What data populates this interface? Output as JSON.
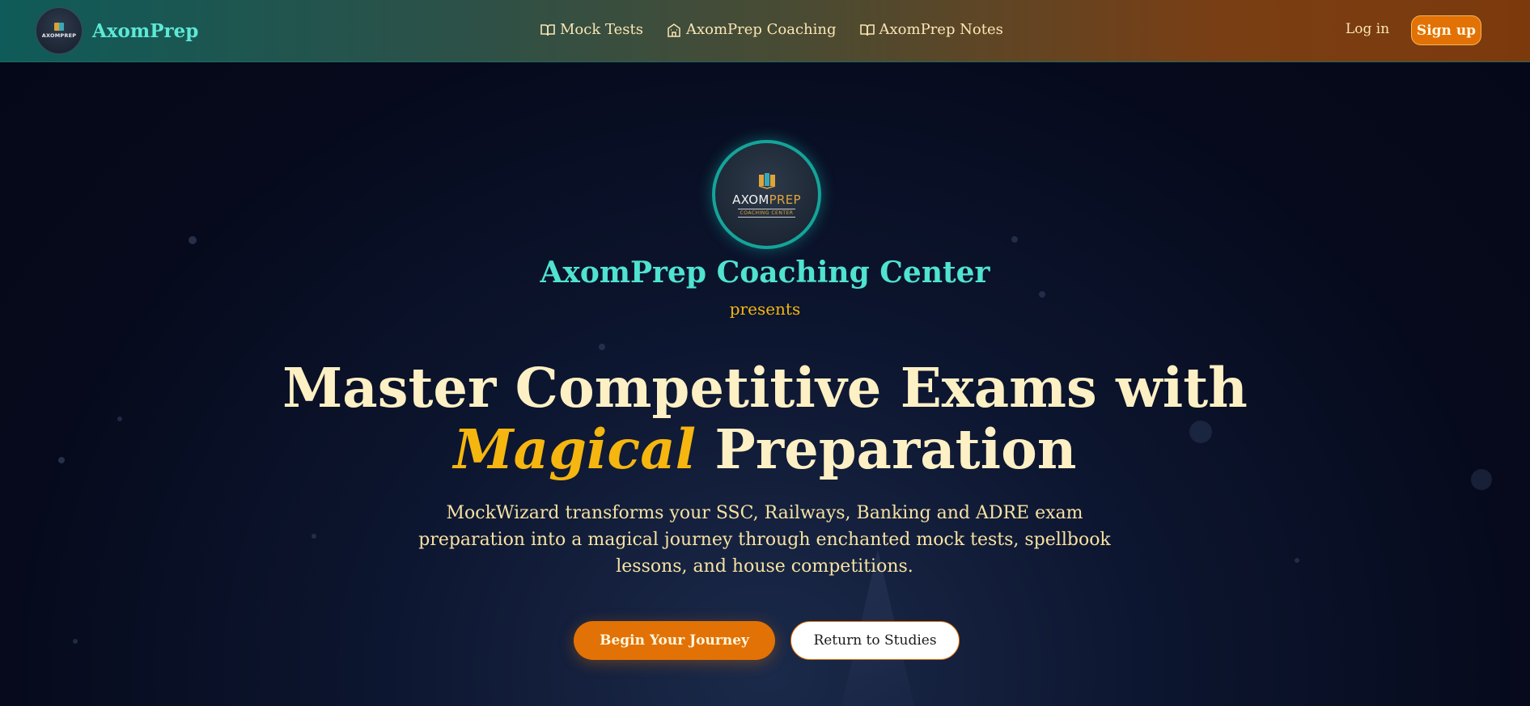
{
  "nav": {
    "brand_logo_text": "AXOMPREP",
    "brand_name": "AxomPrep",
    "links": [
      {
        "label": "Mock Tests",
        "icon": "book-open-icon"
      },
      {
        "label": "AxomPrep Coaching",
        "icon": "building-icon"
      },
      {
        "label": "AxomPrep Notes",
        "icon": "book-open-icon"
      }
    ],
    "login_label": "Log in",
    "signup_label": "Sign up"
  },
  "hero": {
    "logo": {
      "line1_a": "AXOM",
      "line1_b": "PREP",
      "line2": "COACHING CENTER"
    },
    "center_title": "AxomPrep Coaching Center",
    "presents": "presents",
    "headline_line1": "Master Competitive Exams with",
    "headline_magic": "Magical",
    "headline_line2_rest": " Preparation",
    "subtitle": "MockWizard transforms your SSC, Railways, Banking and ADRE exam preparation into a magical journey through enchanted mock tests, spellbook lessons, and house competitions.",
    "primary_button": "Begin Your Journey",
    "secondary_button": "Return to Studies"
  },
  "colors": {
    "accent_orange": "#e27205",
    "accent_teal": "#4fe3d0",
    "accent_gold": "#f5b60f",
    "background": "#060a1c"
  }
}
